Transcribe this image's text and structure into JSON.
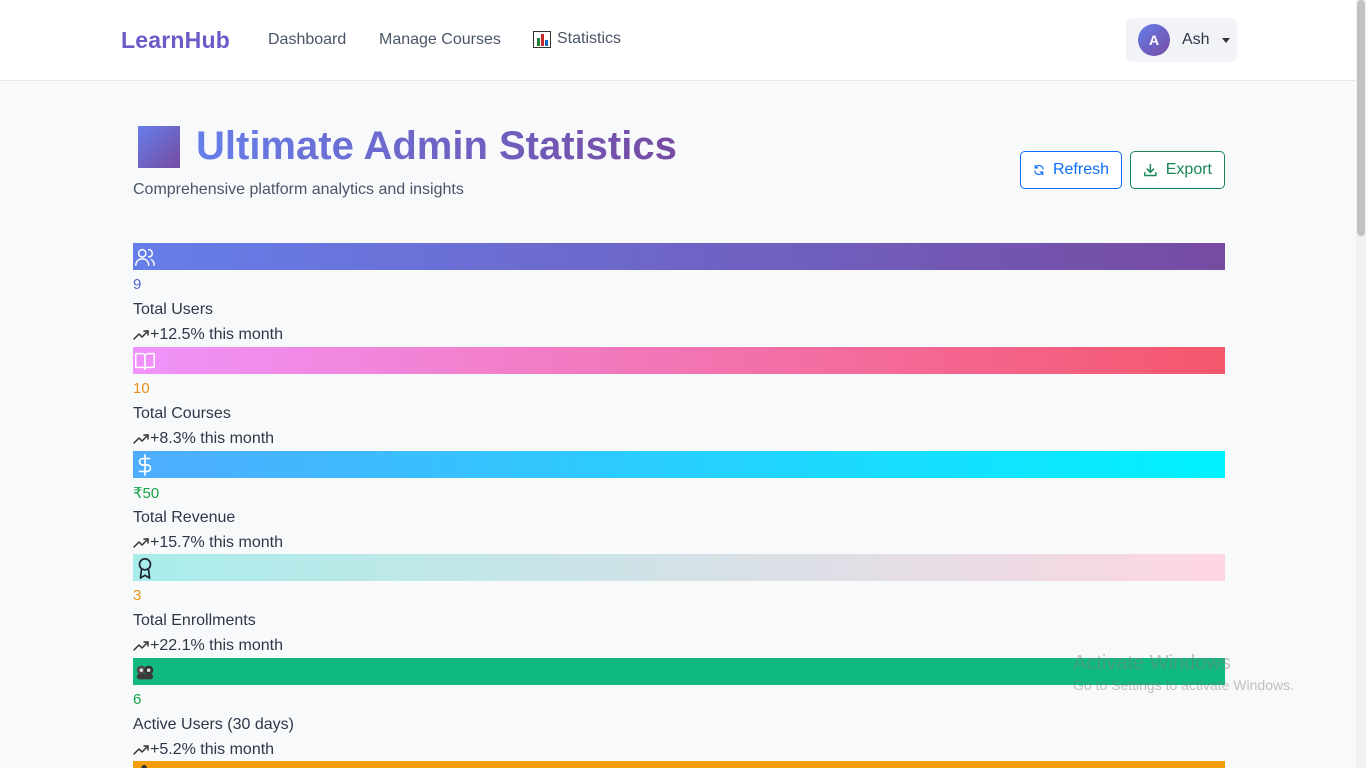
{
  "nav": {
    "brand": "LearnHub",
    "links": [
      "Dashboard",
      "Manage Courses",
      "Statistics"
    ],
    "user": {
      "initial": "A",
      "name": "Ash"
    }
  },
  "header": {
    "title": "Ultimate Admin Statistics",
    "subtitle": "Comprehensive platform analytics and insights",
    "refresh_label": "Refresh",
    "export_label": "Export"
  },
  "stats": [
    {
      "icon": "users-icon",
      "value": "9",
      "label": "Total Users",
      "trend": "+12.5% this month",
      "value_color": "#4c63d2",
      "gradient": [
        "#667eea",
        "#764ba2"
      ]
    },
    {
      "icon": "book-icon",
      "value": "10",
      "label": "Total Courses",
      "trend": "+8.3% this month",
      "value_color": "#e8911a",
      "gradient": [
        "#f093fb",
        "#f5576c"
      ]
    },
    {
      "icon": "dollar-icon",
      "value": "₹50",
      "label": "Total Revenue",
      "trend": "+15.7% this month",
      "value_color": "#16a34a",
      "gradient": [
        "#4facfe",
        "#00f2fe"
      ]
    },
    {
      "icon": "award-icon",
      "value": "3",
      "label": "Total Enrollments",
      "trend": "+22.1% this month",
      "value_color": "#e8911a",
      "gradient": [
        "#a8edea",
        "#fed6e3"
      ]
    },
    {
      "icon": "people-emoji-icon",
      "value": "6",
      "label": "Active Users (30 days)",
      "trend": "+5.2% this month",
      "value_color": "#16a34a",
      "gradient": [
        "#10b981",
        "#10b981"
      ]
    },
    {
      "icon": "partial-icon",
      "value": "",
      "label": "",
      "trend": "",
      "value_color": "#e8911a",
      "gradient": [
        "#f59e0b",
        "#f59e0b"
      ]
    }
  ],
  "watermark": {
    "title": "Activate Windows",
    "subtitle": "Go to Settings to activate Windows."
  }
}
